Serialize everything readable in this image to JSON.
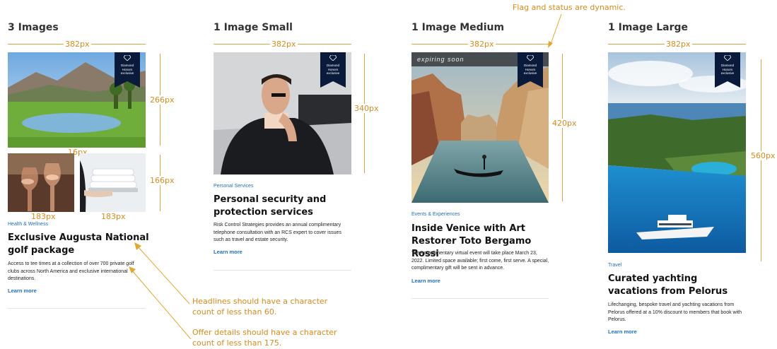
{
  "columns": [
    {
      "title": "3 Images",
      "width_label": "382px",
      "height_labels": [
        "266px",
        "166px"
      ],
      "gap_label": "16px",
      "small_width_labels": [
        "183px",
        "183px"
      ],
      "badge": {
        "line1": "Diamond",
        "line2": "Honors",
        "line3": "exclusive"
      },
      "category": "Health & Wellness",
      "headline": "Exclusive Augusta National golf package",
      "description": "Access to tee times at a collection of over 700 private golf clubs across North America and exclusive international destinations.",
      "link": "Learn more"
    },
    {
      "title": "1 Image Small",
      "width_label": "382px",
      "height_label": "340px",
      "badge": {
        "line1": "Diamond",
        "line2": "Honors",
        "line3": "exclusive"
      },
      "category": "Personal Services",
      "headline": "Personal security and protection services",
      "description": "Risk Control Strategies provides an annual complimentary telephone consultation with an RCS expert to cover issues such as travel and estate security.",
      "link": "Learn more"
    },
    {
      "title": "1 Image Medium",
      "width_label": "382px",
      "height_label": "420px",
      "status": "expiring soon",
      "badge": {
        "line1": "Diamond",
        "line2": "Honors",
        "line3": "exclusive"
      },
      "category": "Events & Experiences",
      "headline": "Inside Venice with Art Restorer Toto Bergamo Rossi",
      "description": "The complimentary virtual event will take place March 23, 2022. Limited space available; first come, first serve. A special, complimentary gift will be sent in advance.",
      "link": "Learn more"
    },
    {
      "title": "1 Image Large",
      "width_label": "382px",
      "height_label": "560px",
      "badge": {
        "line1": "Diamond",
        "line2": "Honors",
        "line3": "exclusive"
      },
      "category": "Travel",
      "headline": "Curated yachting vacations from Pelorus",
      "description": "Lifechanging, bespoke travel and yachting vacations from Pelorus offered at a 10% discount to members that book with Pelorus.",
      "link": "Learn more"
    }
  ],
  "annotations": {
    "flag": "Flag and status are dynamic.",
    "headline_line1": "Headlines should have a character",
    "headline_line2": "count of less than 60.",
    "offer_line1": "Offer details should have a character",
    "offer_line2": "count of less than 175."
  },
  "colors": {
    "annotation": "#d98a1a",
    "link": "#1e6fc0",
    "badge": "#0a1a3a"
  }
}
